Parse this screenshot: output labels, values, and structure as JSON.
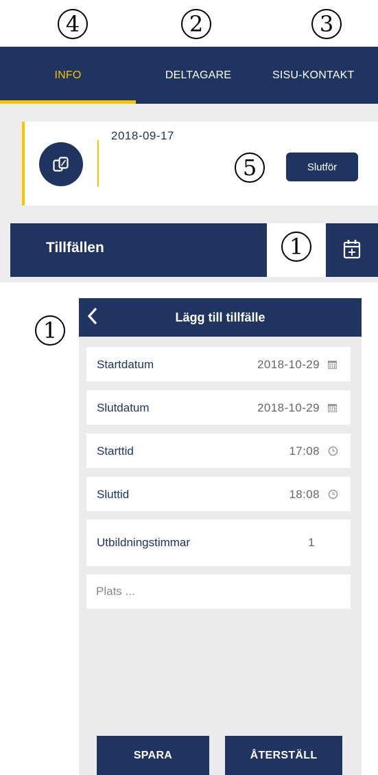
{
  "annotations": {
    "top_markers": [
      "4",
      "2",
      "3"
    ],
    "slutfor_marker": "5",
    "add_marker": "1",
    "panel_marker": "1"
  },
  "tabs": [
    {
      "label": "INFO",
      "active": true
    },
    {
      "label": "DELTAGARE",
      "active": false
    },
    {
      "label": "SISU-KONTAKT",
      "active": false
    }
  ],
  "event_card": {
    "icon": "copy-icon",
    "date": "2018-09-17",
    "finish_button": "Slutför"
  },
  "sessions_section": {
    "title": "Tillfällen",
    "add_icon": "calendar-plus-icon"
  },
  "add_session_form": {
    "title": "Lägg till tillfälle",
    "back_icon": "chevron-left-icon",
    "fields": {
      "start_date": {
        "label": "Startdatum",
        "value": "2018-10-29",
        "icon": "calendar-icon"
      },
      "end_date": {
        "label": "Slutdatum",
        "value": "2018-10-29",
        "icon": "calendar-icon"
      },
      "start_time": {
        "label": "Starttid",
        "value": "17:08",
        "icon": "clock-icon"
      },
      "end_time": {
        "label": "Sluttid",
        "value": "18:08",
        "icon": "clock-icon"
      },
      "training_hours": {
        "label": "Utbildningstimmar",
        "value": "1"
      }
    },
    "place_placeholder": "Plats ...",
    "save_button": "SPARA",
    "reset_button": "ÅTERSTÄLL"
  },
  "colors": {
    "navy": "#1f3460",
    "accent_yellow": "#f6c500",
    "panel_grey": "#ebebeb"
  }
}
